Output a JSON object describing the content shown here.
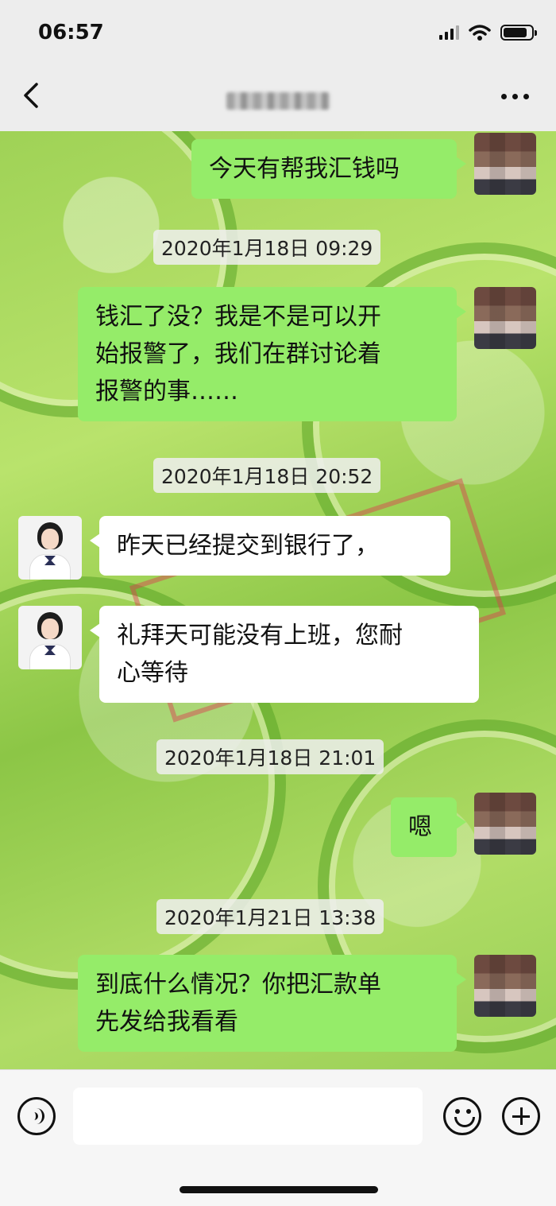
{
  "status_bar": {
    "time": "06:57"
  },
  "nav": {
    "back_icon": "chevron-left-icon",
    "more_icon": "more-icon"
  },
  "messages": [
    {
      "type": "sent",
      "text": "今天有帮我汇钱吗"
    },
    {
      "type": "timestamp",
      "text": "2020年1月18日 09:29"
    },
    {
      "type": "sent",
      "lines": [
        "钱汇了没？我是不是可以开",
        "始报警了，我们在群讨论着",
        "报警的事……"
      ]
    },
    {
      "type": "timestamp",
      "text": "2020年1月18日 20:52"
    },
    {
      "type": "received",
      "text": "昨天已经提交到银行了，"
    },
    {
      "type": "received",
      "lines": [
        "礼拜天可能没有上班，您耐",
        "心等待"
      ]
    },
    {
      "type": "timestamp",
      "text": "2020年1月18日 21:01"
    },
    {
      "type": "sent",
      "text": "嗯"
    },
    {
      "type": "timestamp",
      "text": "2020年1月21日 13:38"
    },
    {
      "type": "sent",
      "lines": [
        "到底什么情况？你把汇款单",
        "先发给我看看"
      ]
    }
  ],
  "input_bar": {
    "voice_icon": "voice-icon",
    "emoji_icon": "emoji-icon",
    "plus_icon": "plus-icon"
  },
  "colors": {
    "sent_bubble": "#95ec69",
    "received_bubble": "#ffffff",
    "header_bg": "#ededed"
  }
}
